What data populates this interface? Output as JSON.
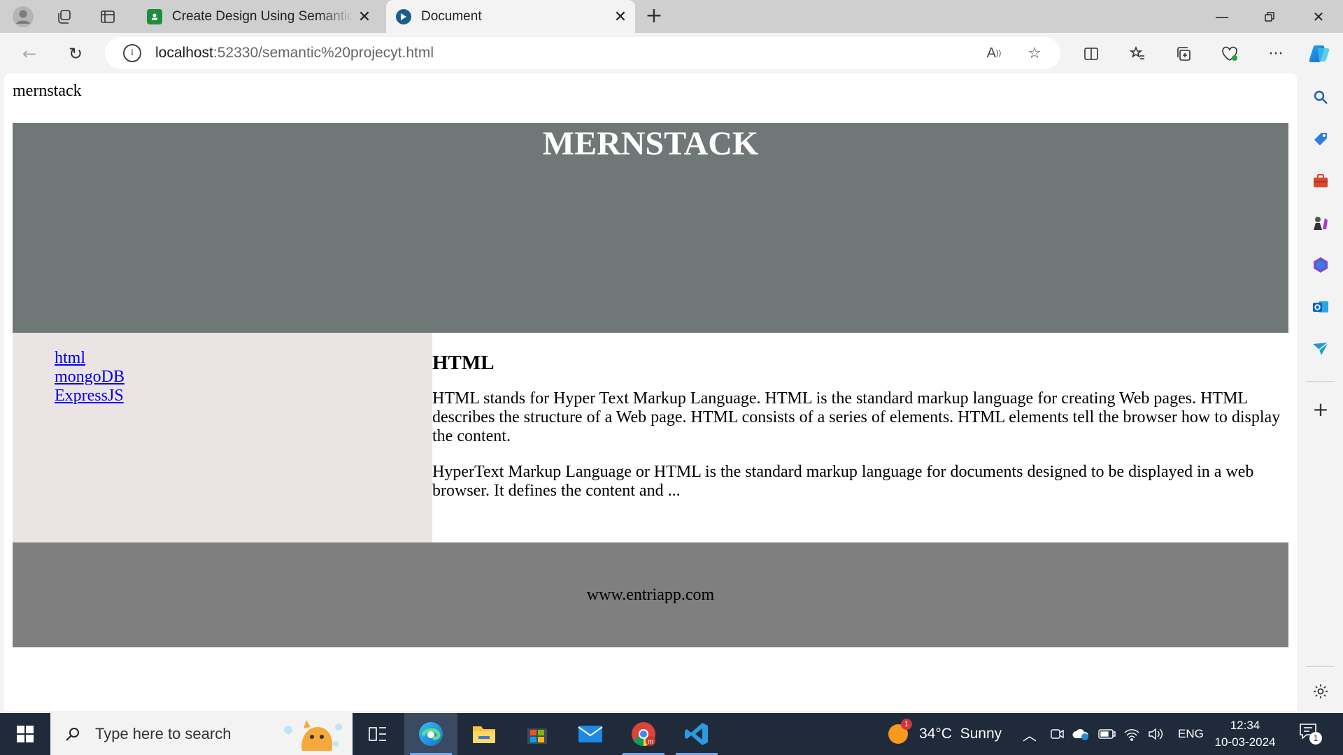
{
  "browser": {
    "tabs": [
      {
        "title": "Create Design Using Semantic Elements",
        "active": false
      },
      {
        "title": "Document",
        "active": true
      }
    ],
    "url_host": "localhost",
    "url_path": ":52330/semantic%20projecyt.html"
  },
  "page": {
    "logo_text": "mernstack",
    "hero_title": "MERNSTACK",
    "nav_links": [
      "html",
      "mongoDB",
      "ExpressJS"
    ],
    "article": {
      "heading": "HTML",
      "paragraphs": [
        "HTML stands for Hyper Text Markup Language. HTML is the standard markup language for creating Web pages. HTML describes the structure of a Web page. HTML consists of a series of elements. HTML elements tell the browser how to display the content.",
        "HyperText Markup Language or HTML is the standard markup language for documents designed to be displayed in a web browser. It defines the content and ..."
      ]
    },
    "footer_text": "www.entriapp.com",
    "colors": {
      "hero_bg": "#6f7777",
      "nav_bg": "#ebe4e4",
      "footer_bg": "#7f7f7f",
      "link": "#0000ee"
    }
  },
  "taskbar": {
    "search_placeholder": "Type here to search",
    "weather": "34°C  Sunny",
    "weather_badge": "1",
    "language": "ENG",
    "time": "12:34",
    "date": "10-03-2024",
    "notification_count": "1"
  }
}
